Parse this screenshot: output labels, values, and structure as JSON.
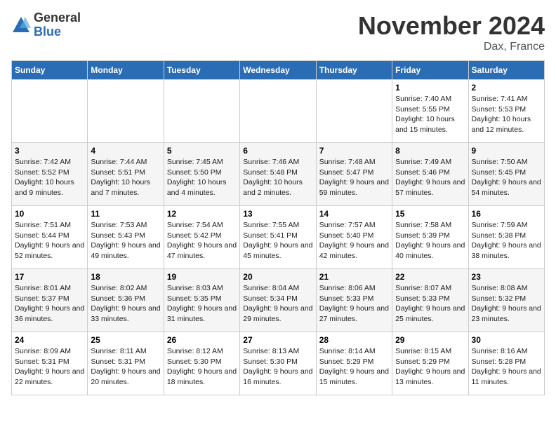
{
  "header": {
    "logo_general": "General",
    "logo_blue": "Blue",
    "month_title": "November 2024",
    "location": "Dax, France"
  },
  "weekdays": [
    "Sunday",
    "Monday",
    "Tuesday",
    "Wednesday",
    "Thursday",
    "Friday",
    "Saturday"
  ],
  "weeks": [
    [
      {
        "day": "",
        "info": ""
      },
      {
        "day": "",
        "info": ""
      },
      {
        "day": "",
        "info": ""
      },
      {
        "day": "",
        "info": ""
      },
      {
        "day": "",
        "info": ""
      },
      {
        "day": "1",
        "info": "Sunrise: 7:40 AM\nSunset: 5:55 PM\nDaylight: 10 hours and 15 minutes."
      },
      {
        "day": "2",
        "info": "Sunrise: 7:41 AM\nSunset: 5:53 PM\nDaylight: 10 hours and 12 minutes."
      }
    ],
    [
      {
        "day": "3",
        "info": "Sunrise: 7:42 AM\nSunset: 5:52 PM\nDaylight: 10 hours and 9 minutes."
      },
      {
        "day": "4",
        "info": "Sunrise: 7:44 AM\nSunset: 5:51 PM\nDaylight: 10 hours and 7 minutes."
      },
      {
        "day": "5",
        "info": "Sunrise: 7:45 AM\nSunset: 5:50 PM\nDaylight: 10 hours and 4 minutes."
      },
      {
        "day": "6",
        "info": "Sunrise: 7:46 AM\nSunset: 5:48 PM\nDaylight: 10 hours and 2 minutes."
      },
      {
        "day": "7",
        "info": "Sunrise: 7:48 AM\nSunset: 5:47 PM\nDaylight: 9 hours and 59 minutes."
      },
      {
        "day": "8",
        "info": "Sunrise: 7:49 AM\nSunset: 5:46 PM\nDaylight: 9 hours and 57 minutes."
      },
      {
        "day": "9",
        "info": "Sunrise: 7:50 AM\nSunset: 5:45 PM\nDaylight: 9 hours and 54 minutes."
      }
    ],
    [
      {
        "day": "10",
        "info": "Sunrise: 7:51 AM\nSunset: 5:44 PM\nDaylight: 9 hours and 52 minutes."
      },
      {
        "day": "11",
        "info": "Sunrise: 7:53 AM\nSunset: 5:43 PM\nDaylight: 9 hours and 49 minutes."
      },
      {
        "day": "12",
        "info": "Sunrise: 7:54 AM\nSunset: 5:42 PM\nDaylight: 9 hours and 47 minutes."
      },
      {
        "day": "13",
        "info": "Sunrise: 7:55 AM\nSunset: 5:41 PM\nDaylight: 9 hours and 45 minutes."
      },
      {
        "day": "14",
        "info": "Sunrise: 7:57 AM\nSunset: 5:40 PM\nDaylight: 9 hours and 42 minutes."
      },
      {
        "day": "15",
        "info": "Sunrise: 7:58 AM\nSunset: 5:39 PM\nDaylight: 9 hours and 40 minutes."
      },
      {
        "day": "16",
        "info": "Sunrise: 7:59 AM\nSunset: 5:38 PM\nDaylight: 9 hours and 38 minutes."
      }
    ],
    [
      {
        "day": "17",
        "info": "Sunrise: 8:01 AM\nSunset: 5:37 PM\nDaylight: 9 hours and 36 minutes."
      },
      {
        "day": "18",
        "info": "Sunrise: 8:02 AM\nSunset: 5:36 PM\nDaylight: 9 hours and 33 minutes."
      },
      {
        "day": "19",
        "info": "Sunrise: 8:03 AM\nSunset: 5:35 PM\nDaylight: 9 hours and 31 minutes."
      },
      {
        "day": "20",
        "info": "Sunrise: 8:04 AM\nSunset: 5:34 PM\nDaylight: 9 hours and 29 minutes."
      },
      {
        "day": "21",
        "info": "Sunrise: 8:06 AM\nSunset: 5:33 PM\nDaylight: 9 hours and 27 minutes."
      },
      {
        "day": "22",
        "info": "Sunrise: 8:07 AM\nSunset: 5:33 PM\nDaylight: 9 hours and 25 minutes."
      },
      {
        "day": "23",
        "info": "Sunrise: 8:08 AM\nSunset: 5:32 PM\nDaylight: 9 hours and 23 minutes."
      }
    ],
    [
      {
        "day": "24",
        "info": "Sunrise: 8:09 AM\nSunset: 5:31 PM\nDaylight: 9 hours and 22 minutes."
      },
      {
        "day": "25",
        "info": "Sunrise: 8:11 AM\nSunset: 5:31 PM\nDaylight: 9 hours and 20 minutes."
      },
      {
        "day": "26",
        "info": "Sunrise: 8:12 AM\nSunset: 5:30 PM\nDaylight: 9 hours and 18 minutes."
      },
      {
        "day": "27",
        "info": "Sunrise: 8:13 AM\nSunset: 5:30 PM\nDaylight: 9 hours and 16 minutes."
      },
      {
        "day": "28",
        "info": "Sunrise: 8:14 AM\nSunset: 5:29 PM\nDaylight: 9 hours and 15 minutes."
      },
      {
        "day": "29",
        "info": "Sunrise: 8:15 AM\nSunset: 5:29 PM\nDaylight: 9 hours and 13 minutes."
      },
      {
        "day": "30",
        "info": "Sunrise: 8:16 AM\nSunset: 5:28 PM\nDaylight: 9 hours and 11 minutes."
      }
    ]
  ]
}
